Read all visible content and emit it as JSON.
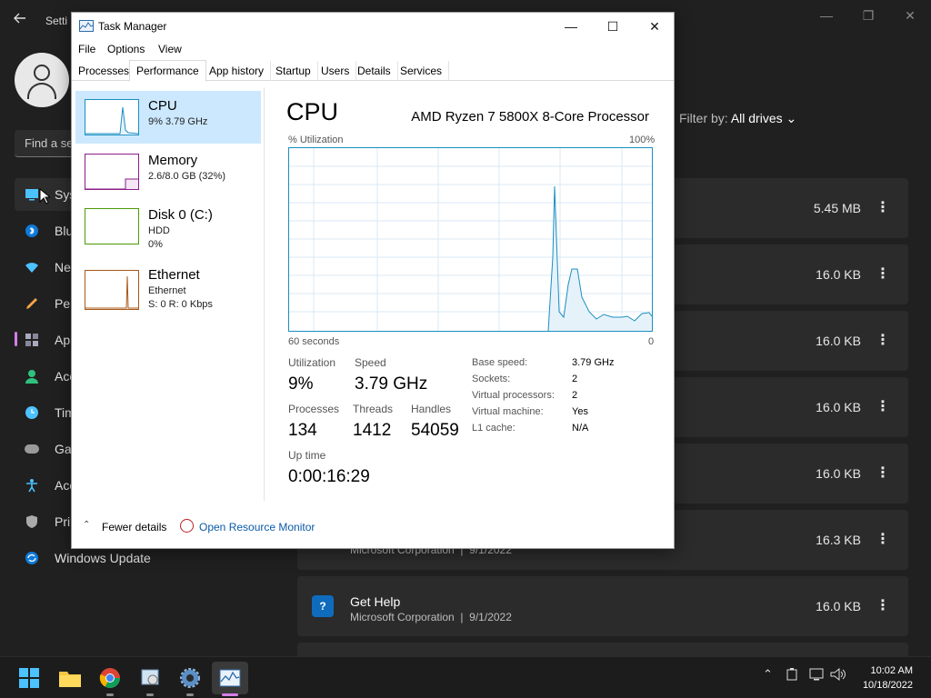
{
  "settings": {
    "title": "Setti",
    "search_placeholder": "Find a se",
    "nav": [
      {
        "label": "Sys",
        "icon": "system-icon"
      },
      {
        "label": "Blu",
        "icon": "bluetooth-icon"
      },
      {
        "label": "Ne",
        "icon": "network-icon"
      },
      {
        "label": "Per",
        "icon": "personalization-icon"
      },
      {
        "label": "Ap",
        "icon": "apps-icon"
      },
      {
        "label": "Acc",
        "icon": "accounts-icon"
      },
      {
        "label": "Tim",
        "icon": "time-icon"
      },
      {
        "label": "Ga",
        "icon": "gaming-icon"
      },
      {
        "label": "Acc",
        "icon": "accessibility-icon"
      },
      {
        "label": "Pri",
        "icon": "privacy-icon"
      },
      {
        "label": "Windows Update",
        "icon": "windows-update-icon"
      }
    ],
    "filter_label": "Filter by:",
    "filter_value": "All drives",
    "apps": [
      {
        "size": "5.45 MB",
        "name": "",
        "publisher": "",
        "date": ""
      },
      {
        "size": "16.0 KB",
        "name": "",
        "publisher": "",
        "date": ""
      },
      {
        "size": "16.0 KB",
        "name": "",
        "publisher": "",
        "date": ""
      },
      {
        "size": "16.0 KB",
        "name": "",
        "publisher": "",
        "date": ""
      },
      {
        "size": "16.0 KB",
        "name": "",
        "publisher": "",
        "date": ""
      },
      {
        "size": "16.3 KB",
        "name": "",
        "publisher": "Microsoft Corporation",
        "date": "9/1/2022"
      },
      {
        "size": "16.0 KB",
        "name": "Get Help",
        "publisher": "Microsoft Corporation",
        "date": "9/1/2022"
      }
    ]
  },
  "taskmgr": {
    "title": "Task Manager",
    "menu": [
      "File",
      "Options",
      "View"
    ],
    "tabs": [
      "Processes",
      "Performance",
      "App history",
      "Startup",
      "Users",
      "Details",
      "Services"
    ],
    "selected_tab": "Performance",
    "devices": {
      "cpu": {
        "name": "CPU",
        "line1": "9%  3.79 GHz"
      },
      "memory": {
        "name": "Memory",
        "line1": "2.6/8.0 GB (32%)"
      },
      "disk": {
        "name": "Disk 0 (C:)",
        "line1": "HDD",
        "line2": "0%"
      },
      "ethernet": {
        "name": "Ethernet",
        "line1": "Ethernet",
        "line2": "S: 0  R: 0 Kbps"
      }
    },
    "cpu_panel": {
      "heading": "CPU",
      "model": "AMD Ryzen 7 5800X 8-Core Processor",
      "graph_label": "% Utilization",
      "graph_max": "100%",
      "graph_time": "60 seconds",
      "graph_zero": "0",
      "utilization_label": "Utilization",
      "utilization": "9%",
      "speed_label": "Speed",
      "speed": "3.79 GHz",
      "processes_label": "Processes",
      "processes": "134",
      "threads_label": "Threads",
      "threads": "1412",
      "handles_label": "Handles",
      "handles": "54059",
      "uptime_label": "Up time",
      "uptime": "0:00:16:29",
      "specs": [
        {
          "label": "Base speed:",
          "value": "3.79 GHz"
        },
        {
          "label": "Sockets:",
          "value": "2"
        },
        {
          "label": "Virtual processors:",
          "value": "2"
        },
        {
          "label": "Virtual machine:",
          "value": "Yes"
        },
        {
          "label": "L1 cache:",
          "value": "N/A"
        }
      ]
    },
    "footer": {
      "fewer": "Fewer details",
      "resmon": "Open Resource Monitor"
    }
  },
  "taskbar": {
    "time": "10:02 AM",
    "date": "10/18/2022"
  },
  "colors": {
    "cpu_line": "#1a8fc1",
    "memory_line": "#8b1a89",
    "disk_line": "#4d9a06",
    "ethernet_line": "#a7581b",
    "selection": "#cce8ff"
  }
}
